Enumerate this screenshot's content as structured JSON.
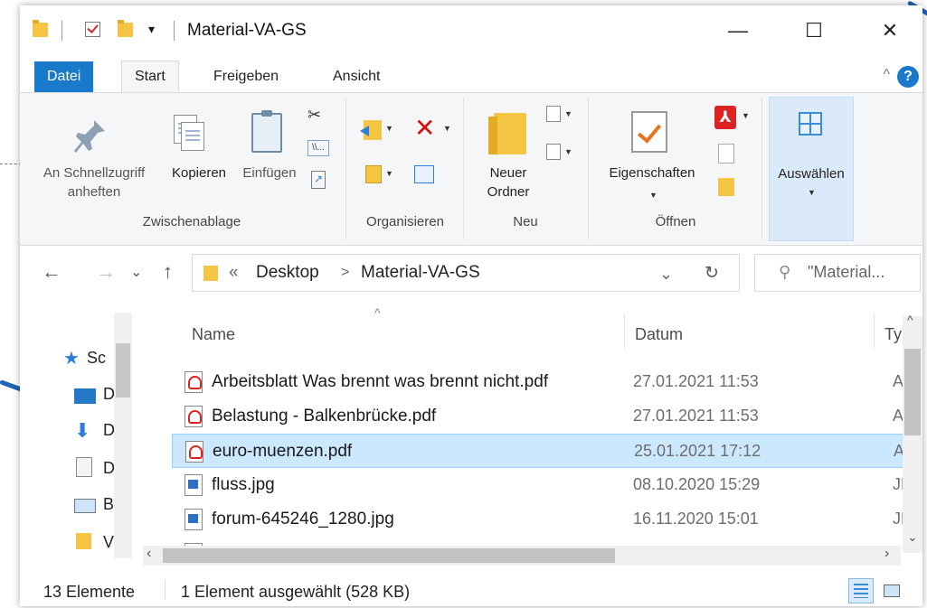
{
  "window": {
    "title": "Material-VA-GS",
    "minimize_glyph": "—",
    "maximize_glyph": "☐",
    "close_glyph": "✕"
  },
  "tabs": [
    "Datei",
    "Start",
    "Freigeben",
    "Ansicht"
  ],
  "help_glyph": "?",
  "collapse_glyph": "^",
  "ribbon": {
    "pin_label_1": "An Schnellzugriff",
    "pin_label_2": "anheften",
    "copy_label": "Kopieren",
    "paste_label": "Einfügen",
    "new_folder_label_1": "Neuer",
    "new_folder_label_2": "Ordner",
    "properties_label": "Eigenschaften",
    "select_label": "Auswählen",
    "groups": {
      "clipboard": "Zwischenablage",
      "organize": "Organisieren",
      "new": "Neu",
      "open": "Öffnen"
    }
  },
  "address": {
    "overflow": "«",
    "crumbs": [
      "Desktop",
      "Material-VA-GS"
    ],
    "separator": ">",
    "search_placeholder": "\"Material..."
  },
  "nav": {
    "back": "←",
    "forward": "→",
    "recent": "⌄",
    "up": "↑",
    "refresh": "↻",
    "dropdown": "⌄",
    "items": [
      "Sc",
      "D",
      "D",
      "D",
      "B",
      "V"
    ]
  },
  "list": {
    "columns": [
      "Name",
      "Datum",
      "Typ"
    ],
    "rows": [
      {
        "name": "Arbeitsblatt Was brennt was brennt nicht.pdf",
        "date": "27.01.2021 11:53",
        "type": "Ado",
        "kind": "pdf",
        "selected": false
      },
      {
        "name": "Belastung - Balkenbrücke.pdf",
        "date": "27.01.2021 11:53",
        "type": "Ado",
        "kind": "pdf",
        "selected": false
      },
      {
        "name": "euro-muenzen.pdf",
        "date": "25.01.2021 17:12",
        "type": "Ado",
        "kind": "pdf",
        "selected": true
      },
      {
        "name": "fluss.jpg",
        "date": "08.10.2020 15:29",
        "type": "JPG",
        "kind": "jpg",
        "selected": false
      },
      {
        "name": "forum-645246_1280.jpg",
        "date": "16.11.2020 15:01",
        "type": "JPG",
        "kind": "jpg",
        "selected": false
      }
    ]
  },
  "status": {
    "count": "13 Elemente",
    "selection": "1 Element ausgewählt (528 KB)"
  },
  "colors": {
    "accent": "#1979ca",
    "selected_row": "#cce8ff",
    "annotation": "#1f63b6"
  }
}
